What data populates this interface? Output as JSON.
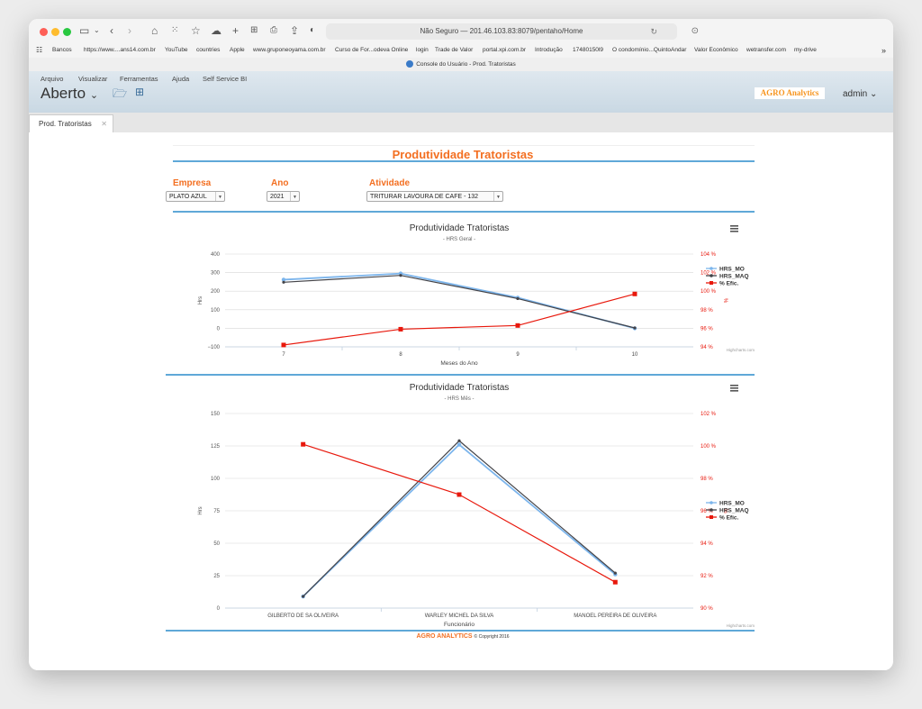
{
  "browser": {
    "address": "Não Seguro — 201.46.103.83:8079/pentaho/Home",
    "tab_title": "Console do Usuário - Prod. Tratoristas",
    "bookmarks": [
      "Bancos",
      "https://www....ans14.com.br",
      "YouTube",
      "countries",
      "Apple",
      "www.gruponeoyama.com.br",
      "Curso de For...odeva Online",
      "login",
      "Trade de Valor",
      "portal.xpi.com.br",
      "Introdução",
      "17480150l9",
      "O condomínio...QuintoAndar",
      "Valor Econômico",
      "wetransfer.com",
      "my-drive"
    ]
  },
  "app": {
    "menu": [
      "Arquivo",
      "Visualizar",
      "Ferramentas",
      "Ajuda",
      "Self Service BI"
    ],
    "mode": "Aberto",
    "logo_text": "AGRO Analytics",
    "user": "admin",
    "open_tab": "Prod. Tratoristas"
  },
  "report": {
    "title": "Produtividade Tratoristas",
    "filters": [
      {
        "label": "Empresa",
        "value": "PLATO AZUL"
      },
      {
        "label": "Ano",
        "value": "2021"
      },
      {
        "label": "Atividade",
        "value": "TRITURAR LAVOURA DE CAFE - 132"
      }
    ],
    "footer_brand": "AGRO ANALYTICS",
    "footer_copy": "© Copyright 2016"
  },
  "colors": {
    "accent": "#f36f21",
    "rule": "#5fa8d8",
    "hrs_mo": "#7cb5ec",
    "hrs_maq": "#434348",
    "efic": "#e8180c"
  },
  "chart_data": [
    {
      "type": "line",
      "title": "Produtividade Tratoristas",
      "subtitle": "- HRS Geral -",
      "xlabel": "Meses do Ano",
      "ylabel": "Hrs",
      "y2label": "%",
      "categories": [
        "7",
        "8",
        "9",
        "10"
      ],
      "ylim": [
        -100,
        400
      ],
      "yticks": [
        "400",
        "300",
        "200",
        "100",
        "0",
        "−100"
      ],
      "y2lim": [
        94,
        104
      ],
      "y2ticks": [
        "104 %",
        "102 %",
        "100 %",
        "98 %",
        "96 %",
        "94 %"
      ],
      "series": [
        {
          "name": "HRS_MO",
          "axis": "y",
          "values": [
            262,
            295,
            165,
            0
          ]
        },
        {
          "name": "HRS_MAQ",
          "axis": "y",
          "values": [
            248,
            285,
            160,
            2
          ]
        },
        {
          "name": "% Efic.",
          "axis": "y2",
          "values": [
            94.2,
            95.9,
            96.3,
            99.7
          ]
        }
      ],
      "legend": "right",
      "credits": "Highcharts.com",
      "grid": true
    },
    {
      "type": "line",
      "title": "Produtividade Tratoristas",
      "subtitle": "- HRS Mês -",
      "xlabel": "Funcionário",
      "ylabel": "Hrs",
      "y2label": "%",
      "categories": [
        "GILBERTO DE SA OLIVEIRA",
        "WARLEY MICHEL DA SILVA",
        "MANOEL PEREIRA DE OLIVEIRA"
      ],
      "ylim": [
        0,
        150
      ],
      "yticks": [
        "150",
        "125",
        "100",
        "75",
        "50",
        "25",
        "0"
      ],
      "y2lim": [
        90,
        102
      ],
      "y2ticks": [
        "102 %",
        "100 %",
        "98 %",
        "96 %",
        "94 %",
        "92 %",
        "90 %"
      ],
      "series": [
        {
          "name": "HRS_MO",
          "axis": "y",
          "values": [
            9,
            126,
            26
          ]
        },
        {
          "name": "HRS_MAQ",
          "axis": "y",
          "values": [
            9,
            129,
            27
          ]
        },
        {
          "name": "% Efic.",
          "axis": "y2",
          "values": [
            100.1,
            97.0,
            91.6
          ]
        }
      ],
      "legend": "right",
      "credits": "Highcharts.com",
      "grid": true
    }
  ]
}
